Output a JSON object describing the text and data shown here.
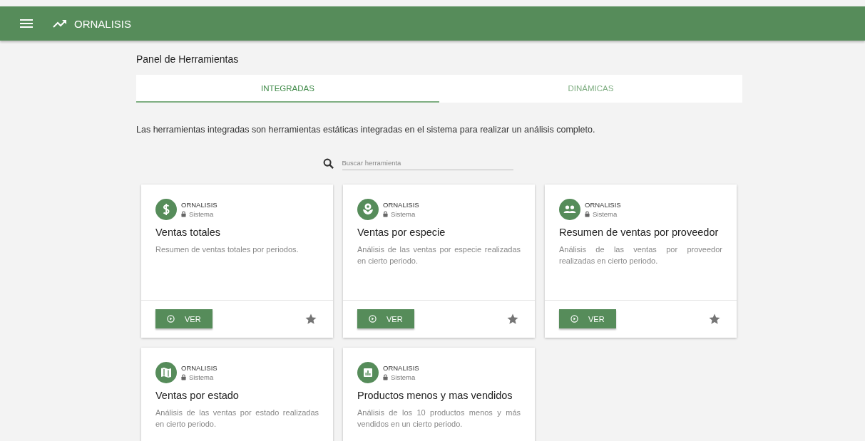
{
  "app_bar": {
    "title": "ORNALISIS"
  },
  "page_title": "Panel de Herramientas",
  "tabs": [
    {
      "label": "INTEGRADAS",
      "selected": true
    },
    {
      "label": "DINÁMICAS",
      "selected": false
    }
  ],
  "intro": "Las herramientas integradas son herramientas estáticas integradas en el sistema para realizar un análisis completo.",
  "search": {
    "placeholder": "Buscar herramienta"
  },
  "cards": [
    {
      "kind": "dollar",
      "owner": "ORNALISIS",
      "visibility": "Sistema",
      "title": "Ventas totales",
      "description": "Resumen de ventas totales por periodos.",
      "button": "VER"
    },
    {
      "kind": "flower",
      "owner": "ORNALISIS",
      "visibility": "Sistema",
      "title": "Ventas por especie",
      "description": "Análisis de las ventas por especie realizadas en cierto periodo.",
      "button": "VER"
    },
    {
      "kind": "people",
      "owner": "ORNALISIS",
      "visibility": "Sistema",
      "title": "Resumen de ventas por proveedor",
      "description": "Análisis de las ventas por proveedor realizadas en cierto periodo.",
      "button": "VER"
    },
    {
      "kind": "map",
      "owner": "ORNALISIS",
      "visibility": "Sistema",
      "title": "Ventas por estado",
      "description": "Análisis de las ventas por estado realizadas en cierto periodo."
    },
    {
      "kind": "chart",
      "owner": "ORNALISIS",
      "visibility": "Sistema",
      "title": "Productos menos y mas vendidos",
      "description": "Análisis de los 10 productos menos y más vendidos en un cierto periodo."
    }
  ]
}
